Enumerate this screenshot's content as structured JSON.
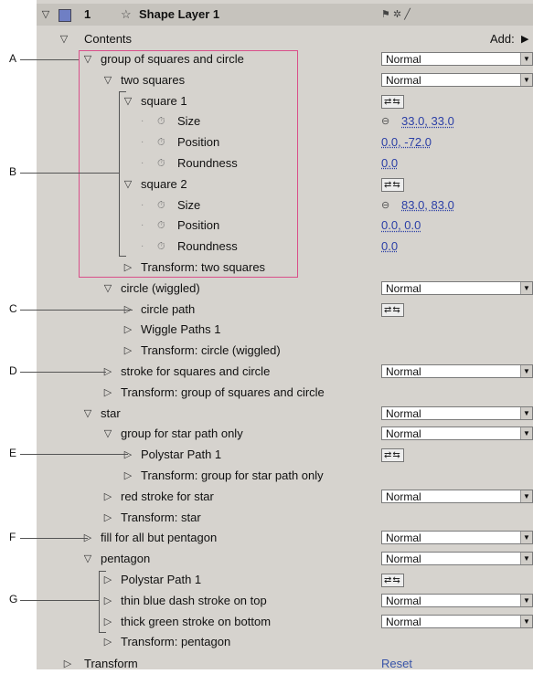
{
  "header": {
    "layer_number": "1",
    "layer_name": "Shape Layer 1",
    "switch_glyphs": "⚑ ✲ ╱"
  },
  "contents_label": "Contents",
  "add_label": "Add:",
  "callouts": [
    "A",
    "B",
    "C",
    "D",
    "E",
    "F",
    "G"
  ],
  "rows": [
    {
      "label": "group of squares and circle",
      "indent": 1,
      "tri": "open",
      "mode": "Normal"
    },
    {
      "label": "two squares",
      "indent": 2,
      "tri": "open",
      "mode": "Normal"
    },
    {
      "label": "square 1",
      "indent": 3,
      "tri": "open",
      "pathicons": true
    },
    {
      "label": "Size",
      "indent": 4,
      "prop": true,
      "link": true,
      "value": "33.0, 33.0"
    },
    {
      "label": "Position",
      "indent": 4,
      "prop": true,
      "value": "0.0, -72.0"
    },
    {
      "label": "Roundness",
      "indent": 4,
      "prop": true,
      "value": "0.0"
    },
    {
      "label": "square 2",
      "indent": 3,
      "tri": "open",
      "pathicons": true
    },
    {
      "label": "Size",
      "indent": 4,
      "prop": true,
      "link": true,
      "value": "83.0, 83.0"
    },
    {
      "label": "Position",
      "indent": 4,
      "prop": true,
      "value": "0.0, 0.0"
    },
    {
      "label": "Roundness",
      "indent": 4,
      "prop": true,
      "value": "0.0"
    },
    {
      "label": "Transform: two squares",
      "indent": 3,
      "tri": "closed"
    },
    {
      "label": "circle (wiggled)",
      "indent": 2,
      "tri": "open",
      "mode": "Normal"
    },
    {
      "label": "circle path",
      "indent": 3,
      "tri": "closed",
      "pathicons": true
    },
    {
      "label": "Wiggle Paths 1",
      "indent": 3,
      "tri": "closed"
    },
    {
      "label": "Transform: circle (wiggled)",
      "indent": 3,
      "tri": "closed"
    },
    {
      "label": "stroke for squares and circle",
      "indent": 2,
      "tri": "closed",
      "mode": "Normal"
    },
    {
      "label": "Transform: group of squares and circle",
      "indent": 2,
      "tri": "closed"
    },
    {
      "label": "star",
      "indent": 1,
      "tri": "open",
      "mode": "Normal"
    },
    {
      "label": "group for star path only",
      "indent": 2,
      "tri": "open",
      "mode": "Normal"
    },
    {
      "label": "Polystar Path 1",
      "indent": 3,
      "tri": "closed",
      "pathicons": true
    },
    {
      "label": "Transform: group for star path only",
      "indent": 3,
      "tri": "closed"
    },
    {
      "label": "red stroke for star",
      "indent": 2,
      "tri": "closed",
      "mode": "Normal"
    },
    {
      "label": "Transform: star",
      "indent": 2,
      "tri": "closed"
    },
    {
      "label": "fill for all but pentagon",
      "indent": 1,
      "tri": "closed",
      "mode": "Normal"
    },
    {
      "label": "pentagon",
      "indent": 1,
      "tri": "open",
      "mode": "Normal"
    },
    {
      "label": "Polystar Path 1",
      "indent": 2,
      "tri": "closed",
      "pathicons": true
    },
    {
      "label": "thin blue dash stroke on top",
      "indent": 2,
      "tri": "closed",
      "mode": "Normal"
    },
    {
      "label": "thick green stroke on bottom",
      "indent": 2,
      "tri": "closed",
      "mode": "Normal"
    },
    {
      "label": "Transform: pentagon",
      "indent": 2,
      "tri": "closed"
    }
  ],
  "transform": {
    "label": "Transform",
    "reset": "Reset"
  },
  "colors": {
    "panel": "#d6d3ce",
    "value": "#2b3fa6",
    "box": "#d94f8a",
    "label_swatch": "#6f7fc4"
  }
}
